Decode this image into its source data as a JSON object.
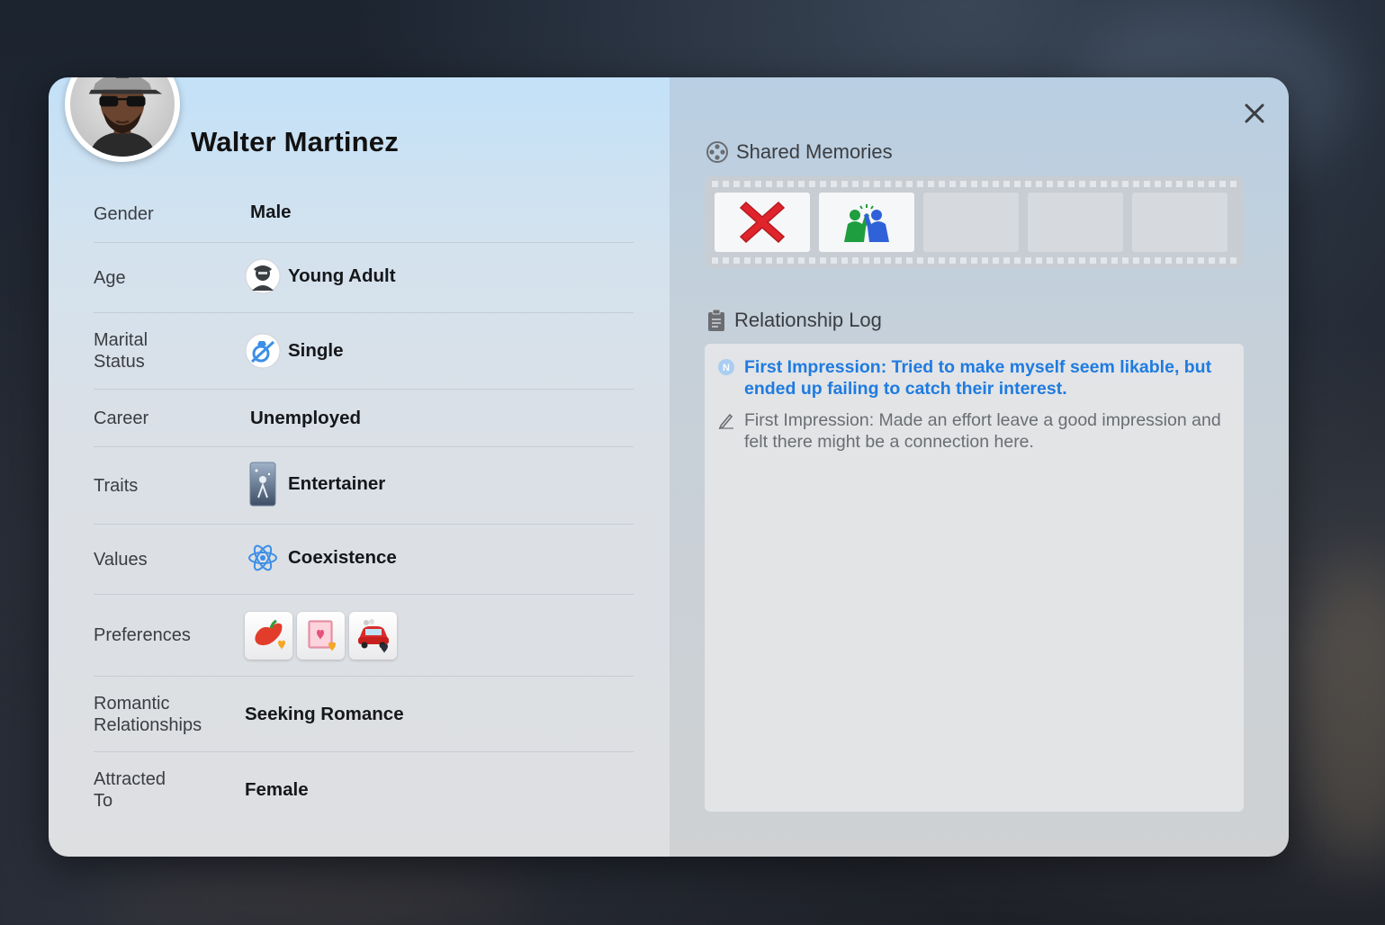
{
  "profile": {
    "name": "Walter Martinez",
    "avatar_icon": "male-sim-sunglasses-cap-portrait"
  },
  "attributes": [
    {
      "key": "gender",
      "label": "Gender",
      "value": "Male"
    },
    {
      "key": "age",
      "label": "Age",
      "value": "Young Adult",
      "icon": "young-adult-age-icon"
    },
    {
      "key": "marital",
      "label": "Marital\nStatus",
      "value": "Single",
      "icon": "single-ring-icon"
    },
    {
      "key": "career",
      "label": "Career",
      "value": "Unemployed"
    },
    {
      "key": "traits",
      "label": "Traits",
      "value": "Entertainer",
      "icon": "entertainer-trait-card-icon"
    },
    {
      "key": "values",
      "label": "Values",
      "value": "Coexistence",
      "icon": "coexistence-atom-icon"
    },
    {
      "key": "preferences",
      "label": "Preferences",
      "items": [
        "spicy-food-like-icon",
        "romance-book-like-icon",
        "car-dislike-icon"
      ]
    },
    {
      "key": "romance",
      "label": "Romantic\nRelationships",
      "value": "Seeking Romance"
    },
    {
      "key": "attracted",
      "label": "Attracted\nTo",
      "value": "Female"
    }
  ],
  "shared_memories": {
    "title": "Shared Memories",
    "frames": [
      "red-x-icon",
      "high-five-icon",
      "",
      "",
      ""
    ]
  },
  "relationship_log": {
    "title": "Relationship Log",
    "entries": [
      {
        "marker": "N",
        "style": "highlight",
        "text": "First Impression: Tried to make myself seem likable, but ended up failing to catch their interest."
      },
      {
        "marker": "pen-icon",
        "style": "normal",
        "text": "First Impression: Made an effort leave a good impression and felt there might be a connection here."
      }
    ]
  },
  "colors": {
    "accent_blue": "#1f7be0",
    "red_x": "#e0242b",
    "high_five_green": "#1e9e3e",
    "high_five_blue": "#2f62d8"
  }
}
